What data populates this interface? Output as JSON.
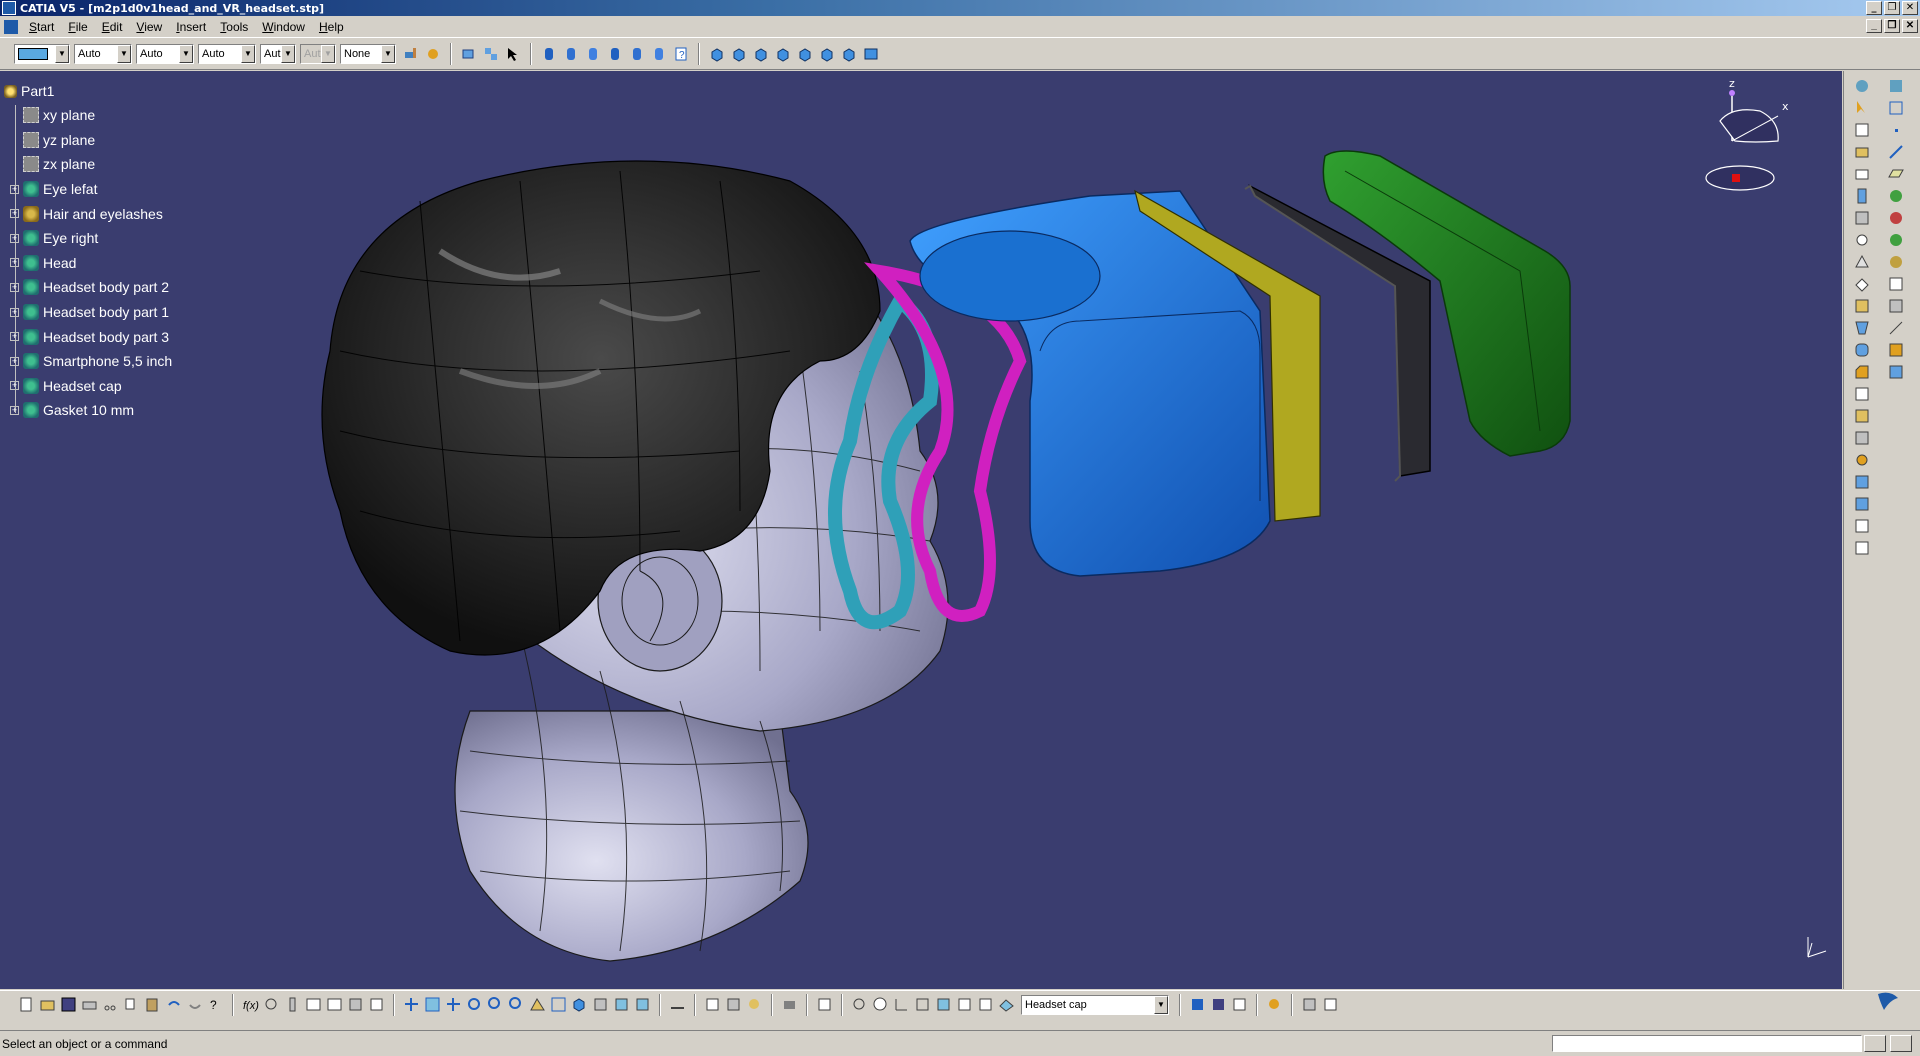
{
  "window": {
    "title": "CATIA V5 - [m2p1d0v1head_and_VR_headset.stp]",
    "controls": [
      "_",
      "❐",
      "✕"
    ]
  },
  "menubar": {
    "items": [
      "Start",
      "File",
      "Edit",
      "View",
      "Insert",
      "Tools",
      "Window",
      "Help"
    ]
  },
  "graphic_properties": {
    "color_value": "",
    "transparency": "Auto",
    "linetype": "Auto",
    "thickness": "Auto",
    "point_symbol": "Aut",
    "disabled_value": "Aut",
    "layer": "None"
  },
  "spec_tree": {
    "root": "Part1",
    "nodes": [
      {
        "label": "xy plane",
        "icon": "plane-icon",
        "expandable": false
      },
      {
        "label": "yz plane",
        "icon": "plane-icon",
        "expandable": false
      },
      {
        "label": "zx plane",
        "icon": "plane-icon",
        "expandable": false
      },
      {
        "label": "Eye lefat",
        "icon": "body-icon",
        "expandable": true
      },
      {
        "label": "Hair and eyelashes",
        "icon": "hair-icon",
        "expandable": true
      },
      {
        "label": "Eye right",
        "icon": "body-icon",
        "expandable": true
      },
      {
        "label": "Head",
        "icon": "body-icon",
        "expandable": true
      },
      {
        "label": "Headset body part 2",
        "icon": "body-icon",
        "expandable": true
      },
      {
        "label": "Headset body part 1",
        "icon": "body-icon",
        "expandable": true
      },
      {
        "label": "Headset body part 3",
        "icon": "body-icon",
        "expandable": true
      },
      {
        "label": "Smartphone 5,5 inch",
        "icon": "body-icon",
        "expandable": true
      },
      {
        "label": "Headset cap",
        "icon": "body-icon",
        "expandable": true
      },
      {
        "label": "Gasket 10 mm",
        "icon": "body-icon",
        "expandable": true
      }
    ]
  },
  "compass": {
    "x_label": "x",
    "z_label": "z"
  },
  "bottom_toolbar": {
    "current_body": "Headset cap"
  },
  "statusbar": {
    "message": "Select an object or a command"
  },
  "colors": {
    "viewport_bg": "#3a3d6f",
    "hair": "#1c1c1c",
    "head": "#a8a8c8",
    "gasket": "#2fa0b8",
    "headset_part_3": "#d020c0",
    "headset_body": "#1e78d8",
    "smartphone_yellow": "#b0a820",
    "smartphone_screen": "#2a2a30",
    "headset_cap": "#1e7a20"
  }
}
